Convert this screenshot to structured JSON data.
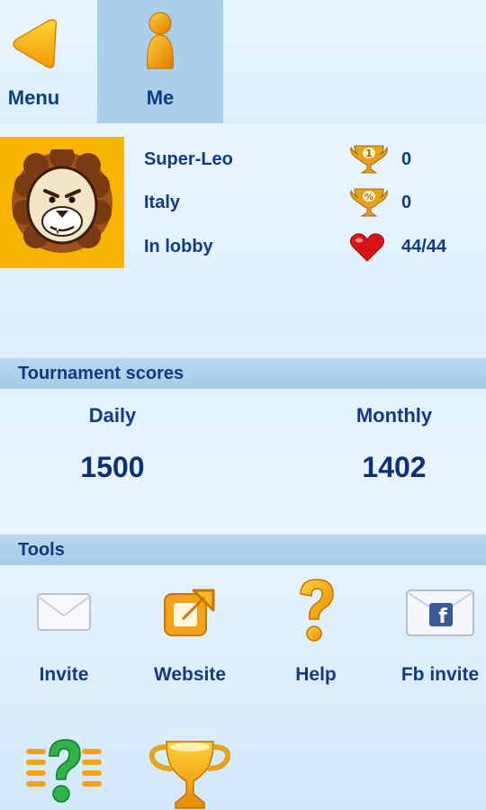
{
  "nav": {
    "menu_label": "Menu",
    "me_label": "Me"
  },
  "profile": {
    "name": "Super-Leo",
    "country": "Italy",
    "status": "In lobby",
    "trophy_count": "0",
    "percent_trophy_count": "0",
    "lives": "44/44",
    "trophy_badge": "1",
    "percent_badge": "%"
  },
  "tournament": {
    "header": "Tournament scores",
    "daily_label": "Daily",
    "daily_value": "1500",
    "monthly_label": "Monthly",
    "monthly_value": "1402"
  },
  "tools": {
    "header": "Tools",
    "items": [
      {
        "label": "Invite",
        "icon": "envelope-icon"
      },
      {
        "label": "Website",
        "icon": "external-link-icon"
      },
      {
        "label": "Help",
        "icon": "question-icon"
      },
      {
        "label": "Fb invite",
        "icon": "facebook-envelope-icon"
      },
      {
        "label": "",
        "icon": "quiz-icon"
      },
      {
        "label": "",
        "icon": "trophy-icon"
      }
    ]
  },
  "colors": {
    "accent_orange": "#f7b500",
    "text_blue": "#143a86",
    "bar_blue": "#a9cfe9"
  }
}
